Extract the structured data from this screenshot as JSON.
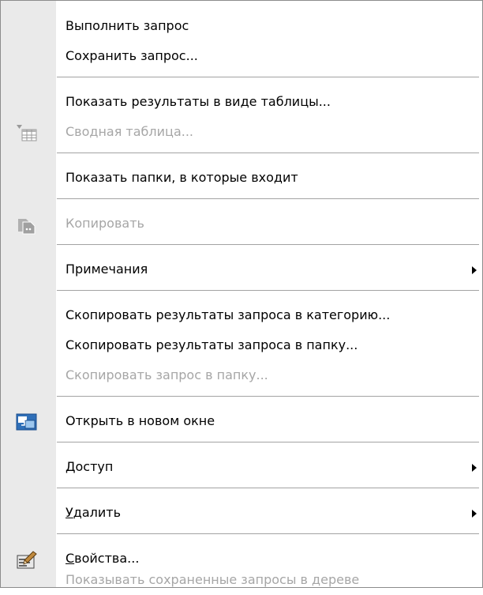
{
  "menu": {
    "items": [
      {
        "label": "Выполнить запрос",
        "disabled": false
      },
      {
        "label": "Сохранить запрос...",
        "disabled": false
      },
      {
        "label": "Показать результаты в виде таблицы...",
        "disabled": false
      },
      {
        "label": "Сводная таблица...",
        "disabled": true,
        "icon": "pivot-table-icon"
      },
      {
        "label": "Показать папки, в которые входит",
        "disabled": false
      },
      {
        "label": "Копировать",
        "disabled": true,
        "icon": "copy-icon"
      },
      {
        "label": "Примечания",
        "disabled": false,
        "submenu": true
      },
      {
        "label": "Скопировать результаты запроса в категорию...",
        "disabled": false
      },
      {
        "label": "Скопировать результаты запроса в папку...",
        "disabled": false
      },
      {
        "label": "Скопировать запрос в папку...",
        "disabled": true
      },
      {
        "label": "Открыть в новом окне",
        "disabled": false,
        "icon": "new-window-icon"
      },
      {
        "label": "Доступ",
        "disabled": false,
        "submenu": true
      },
      {
        "label_first": "У",
        "label_rest": "далить",
        "disabled": false,
        "submenu": true,
        "mnemonic": "У"
      },
      {
        "label_first": "С",
        "label_rest": "войства...",
        "disabled": false,
        "icon": "properties-icon",
        "mnemonic": "С"
      },
      {
        "label": "Показывать сохраненные запросы в дереве",
        "disabled": true
      }
    ]
  },
  "colors": {
    "gutter": "#eaeaea",
    "disabled_text": "#a6a6a6",
    "separator": "#a3a3a3",
    "icon_blue": "#2f6fb8"
  }
}
